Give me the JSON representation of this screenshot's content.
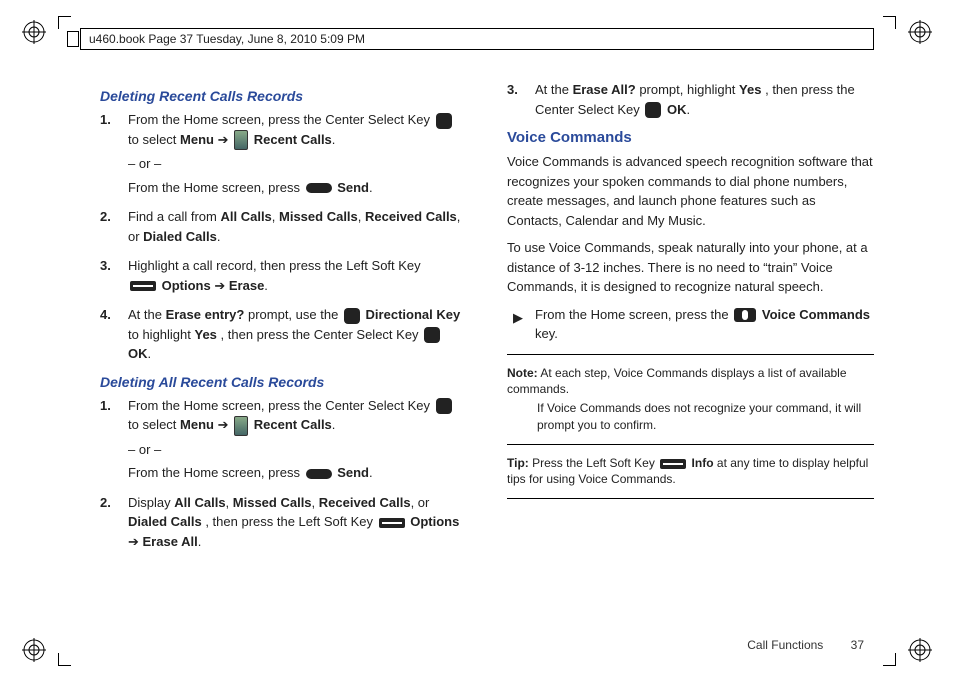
{
  "header": "u460.book  Page 37  Tuesday, June 8, 2010  5:09 PM",
  "left": {
    "h1": "Deleting Recent Calls Records",
    "s1": {
      "n": "1.",
      "a": "From the Home screen, press the Center Select Key ",
      "b": "to select ",
      "menu": "Menu",
      "arrow": " ➔ ",
      "rc": "Recent Calls",
      "dot": ".",
      "or": "– or –",
      "c": "From the Home screen, press ",
      "send": "Send",
      "dot2": "."
    },
    "s2": {
      "n": "2.",
      "a": "Find a call from ",
      "ac": "All Calls",
      "c1": ", ",
      "mc": "Missed Calls",
      "c2": ", ",
      "rc": "Received Calls",
      "c3": ", or ",
      "dc": "Dialed Calls",
      "dot": "."
    },
    "s3": {
      "n": "3.",
      "a": "Highlight a call record, then press the Left Soft Key ",
      "opt": "Options",
      "arrow": " ➔ ",
      "erase": "Erase",
      "dot": "."
    },
    "s4": {
      "n": "4.",
      "a": "At the ",
      "ep": "Erase entry?",
      "b": " prompt, use the ",
      "dk": "Directional Key",
      "c": " to highlight ",
      "yes": "Yes",
      "d": ", then press the Center Select Key ",
      "ok": "OK",
      "dot": "."
    },
    "h2": "Deleting All Recent Calls Records",
    "t1": {
      "n": "1.",
      "a": "From the Home screen, press the Center Select Key ",
      "b": "to select ",
      "menu": "Menu",
      "arrow": " ➔ ",
      "rc": "Recent Calls",
      "dot": ".",
      "or": "– or –",
      "c": "From the Home screen, press ",
      "send": "Send",
      "dot2": "."
    },
    "t2": {
      "n": "2.",
      "a": "Display ",
      "ac": "All Calls",
      "c1": ", ",
      "mc": "Missed Calls",
      "c2": ", ",
      "rc": "Received Calls",
      "c3": ", or ",
      "dc": "Dialed Calls",
      "d": ", then press the Left Soft Key ",
      "opt": "Options",
      "arrow": " ➔ ",
      "ea": "Erase All",
      "dot": "."
    }
  },
  "right": {
    "s3": {
      "n": "3.",
      "a": "At the ",
      "ea": "Erase All?",
      "b": " prompt, highlight ",
      "yes": "Yes",
      "c": ", then press the Center Select Key ",
      "ok": "OK",
      "dot": "."
    },
    "vc_h": "Voice Commands",
    "p1": "Voice Commands is advanced speech recognition software that recognizes your spoken commands to dial phone numbers, create messages, and launch phone features such as Contacts, Calendar and My Music.",
    "p2": "To use Voice Commands, speak naturally into your phone, at a distance of 3-12 inches. There is no need to “train” Voice Commands, it is designed to recognize natural speech.",
    "bul": {
      "a": "From the Home screen, press the ",
      "vc": "Voice Commands",
      "b": " key."
    },
    "note": {
      "label": "Note:",
      "a": "At each step, Voice Commands displays a list of available commands.",
      "b": "If Voice Commands does not recognize your command, it will prompt you to confirm."
    },
    "tip": {
      "label": "Tip:",
      "a": "Press the Left Soft Key ",
      "info": "Info",
      "b": " at any time to display helpful tips for using Voice Commands."
    }
  },
  "footer": {
    "section": "Call Functions",
    "page": "37"
  }
}
